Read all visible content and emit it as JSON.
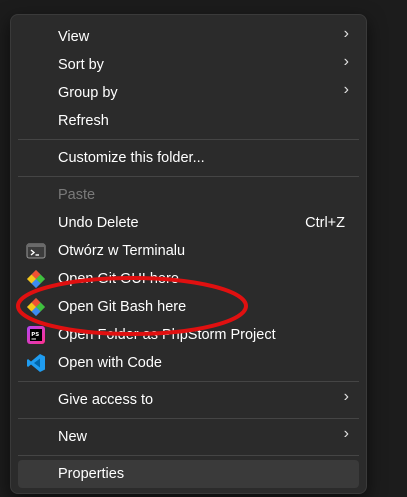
{
  "menu": {
    "items": [
      {
        "label": "View",
        "submenu": "›"
      },
      {
        "label": "Sort by",
        "submenu": "›"
      },
      {
        "label": "Group by",
        "submenu": "›"
      },
      {
        "label": "Refresh"
      },
      {
        "label": "Customize this folder..."
      },
      {
        "label": "Paste",
        "disabled": true
      },
      {
        "label": "Undo Delete",
        "shortcut": "Ctrl+Z"
      },
      {
        "label": "Otwórz w Terminalu",
        "icon": "terminal-icon"
      },
      {
        "label": "Open Git GUI here",
        "icon": "git-diamond-icon"
      },
      {
        "label": "Open Git Bash here",
        "icon": "git-diamond-icon"
      },
      {
        "label": "Open Folder as PhpStorm Project",
        "icon": "phpstorm-icon"
      },
      {
        "label": "Open with Code",
        "icon": "vscode-icon"
      },
      {
        "label": "Give access to",
        "submenu": "›"
      },
      {
        "label": "New",
        "submenu": "›"
      },
      {
        "label": "Properties",
        "hovered": true
      }
    ]
  },
  "colors": {
    "menu_bg": "#2b2b2b",
    "highlight_circle": "#e01010",
    "hover_bg": "#3a3a3a",
    "disabled_text": "#7a7a7a"
  }
}
